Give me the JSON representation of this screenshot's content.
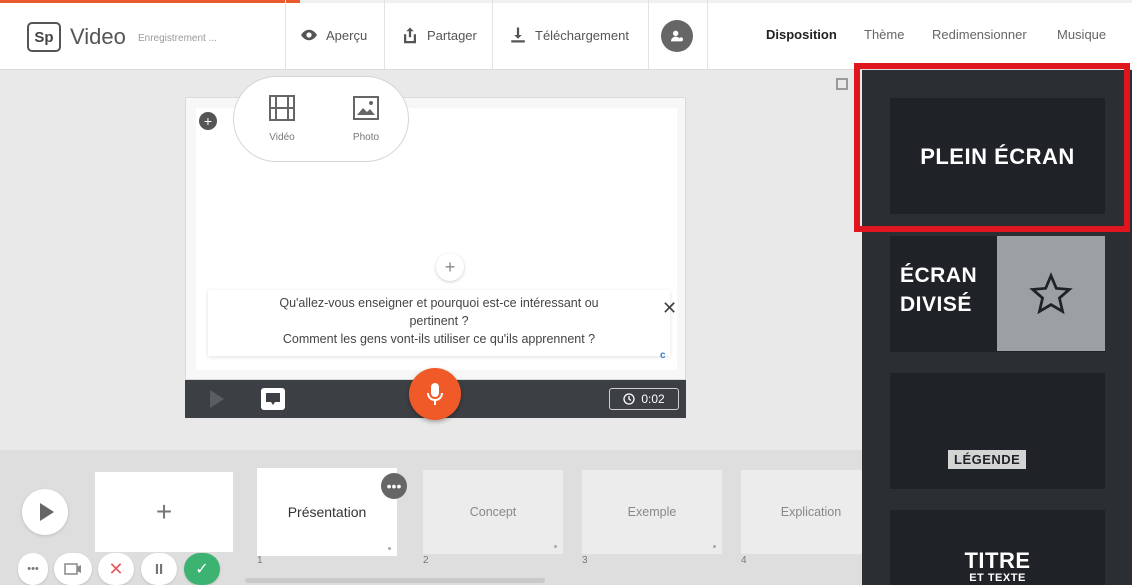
{
  "app": {
    "logo": "Sp",
    "name": "Video",
    "status": "Enregistrement ..."
  },
  "toolbar": {
    "preview_label": "Aperçu",
    "share_label": "Partager",
    "download_label": "Téléchargement"
  },
  "right_tabs": [
    {
      "label": "Disposition",
      "active": true
    },
    {
      "label": "Thème",
      "active": false
    },
    {
      "label": "Redimensionner",
      "active": false
    },
    {
      "label": "Musique",
      "active": false
    }
  ],
  "media_menu": {
    "video_label": "Vidéo",
    "photo_label": "Photo"
  },
  "prompt": {
    "line1": "Qu'allez-vous enseigner et pourquoi est-ce intéressant ou",
    "line2": "pertinent ?",
    "line3": "Comment les gens vont-ils utiliser ce qu'ils apprennent ?",
    "close": "✕"
  },
  "player": {
    "timer": "0:02"
  },
  "storyboard": {
    "add_label": "+",
    "cards": [
      {
        "label": "Présentation",
        "num": "1"
      },
      {
        "label": "Concept",
        "num": "2"
      },
      {
        "label": "Exemple",
        "num": "3"
      },
      {
        "label": "Explication",
        "num": "4"
      }
    ]
  },
  "layouts": {
    "fullscreen": "PLEIN ÉCRAN",
    "split_line1": "ÉCRAN",
    "split_line2": "DIVISÉ",
    "caption": "LÉGENDE",
    "title_line1": "TITRE",
    "title_line2": "ET TEXTE"
  },
  "colors": {
    "accent": "#f05a28",
    "highlight": "#e0161e",
    "panel": "#2b2e32",
    "confirm": "#3cb371"
  }
}
